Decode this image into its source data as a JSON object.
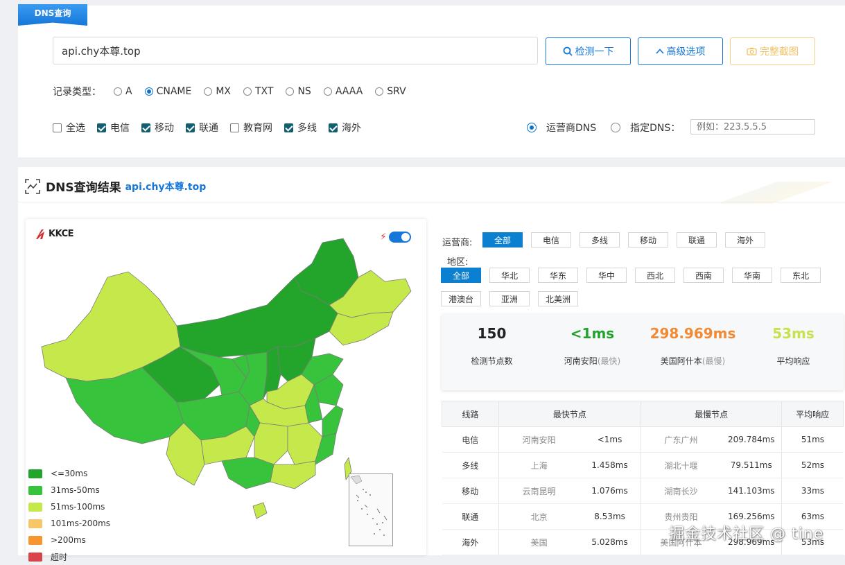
{
  "query": {
    "tab_label": "DNS查询",
    "domain_value": "api.chy本尊.top",
    "btn_check": "检测一下",
    "btn_advanced": "高级选项",
    "btn_screenshot": "完整截图",
    "record_type_label": "记录类型：",
    "record_types": [
      "A",
      "CNAME",
      "MX",
      "TXT",
      "NS",
      "AAAA",
      "SRV"
    ],
    "record_selected": "CNAME",
    "isp_options": [
      {
        "label": "全选",
        "checked": false
      },
      {
        "label": "电信",
        "checked": true
      },
      {
        "label": "移动",
        "checked": true
      },
      {
        "label": "联通",
        "checked": true
      },
      {
        "label": "教育网",
        "checked": false
      },
      {
        "label": "多线",
        "checked": true
      },
      {
        "label": "海外",
        "checked": true
      }
    ],
    "dns_mode_isp": "运营商DNS",
    "dns_mode_custom": "指定DNS：",
    "dns_placeholder": "例如：223.5.5.5"
  },
  "result": {
    "title": "DNS查询结果",
    "domain": "api.chy本尊.top",
    "logo_text": "KKCE",
    "legend": [
      {
        "label": "<=30ms",
        "color": "#22a52a"
      },
      {
        "label": "31ms-50ms",
        "color": "#38c33c"
      },
      {
        "label": "51ms-100ms",
        "color": "#c5e84a"
      },
      {
        "label": "101ms-200ms",
        "color": "#f6c667"
      },
      {
        "label": ">200ms",
        "color": "#f5962e"
      },
      {
        "label": "超时",
        "color": "#d9434a"
      }
    ],
    "filters": {
      "isp_label": "运营商:",
      "isp": [
        "全部",
        "电信",
        "多线",
        "移动",
        "联通",
        "海外"
      ],
      "region_label": "地区:",
      "regions_row1": [
        "全部",
        "华北",
        "华东",
        "华中",
        "西北",
        "西南",
        "华南",
        "东北"
      ],
      "regions_row2": [
        "港澳台",
        "亚洲",
        "北美洲"
      ]
    },
    "stats": [
      {
        "value": "150",
        "label": "检测节点数",
        "sub": "",
        "color": "#222222"
      },
      {
        "value": "<1ms",
        "label": "河南安阳",
        "sub": "(最快)",
        "color": "#25a22e"
      },
      {
        "value": "298.969ms",
        "label": "美国阿什本",
        "sub": "(最慢)",
        "color": "#f08a35"
      },
      {
        "value": "53ms",
        "label": "平均响应",
        "sub": "",
        "color": "#c6e24f"
      }
    ],
    "table": {
      "headers": [
        "线路",
        "最快节点",
        "最慢节点",
        "平均响应"
      ],
      "rows": [
        {
          "line": "电信",
          "fast_node": "河南安阳",
          "fast_ms": "<1ms",
          "slow_node": "广东广州",
          "slow_ms": "209.784ms",
          "avg": "51ms"
        },
        {
          "line": "多线",
          "fast_node": "上海",
          "fast_ms": "1.458ms",
          "slow_node": "湖北十堰",
          "slow_ms": "79.511ms",
          "avg": "52ms"
        },
        {
          "line": "移动",
          "fast_node": "云南昆明",
          "fast_ms": "1.076ms",
          "slow_node": "湖南长沙",
          "slow_ms": "141.103ms",
          "avg": "33ms"
        },
        {
          "line": "联通",
          "fast_node": "北京",
          "fast_ms": "8.53ms",
          "slow_node": "贵州贵阳",
          "slow_ms": "169.256ms",
          "avg": "63ms"
        },
        {
          "line": "海外",
          "fast_node": "美国",
          "fast_ms": "5.028ms",
          "slow_node": "美国阿什本",
          "slow_ms": "298.969ms",
          "avg": "53ms"
        }
      ]
    },
    "watermark": "掘金技术社区 @ tine"
  }
}
